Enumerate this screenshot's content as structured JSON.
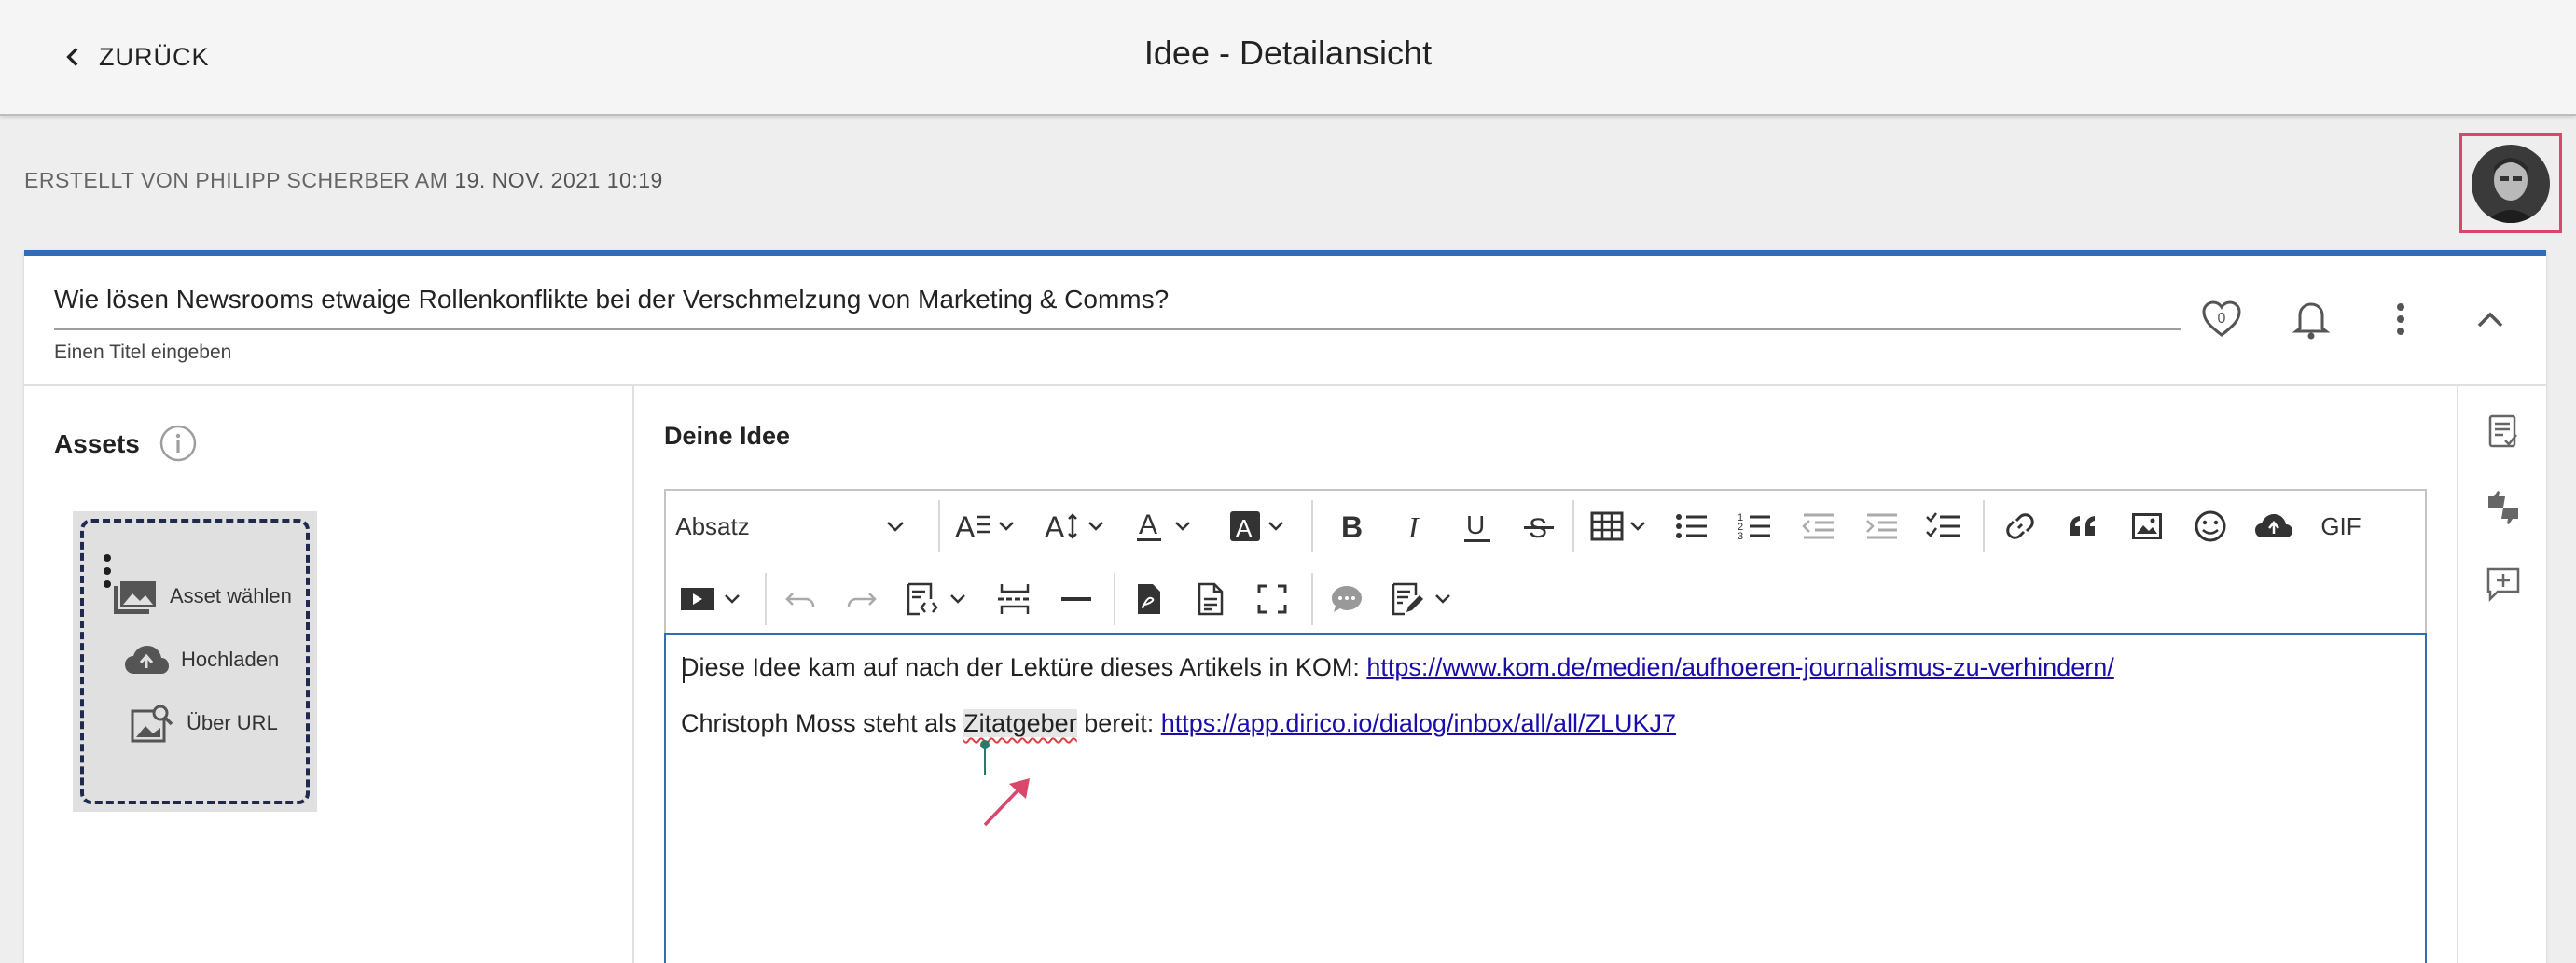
{
  "header": {
    "back_label": "ZURÜCK",
    "title": "Idee - Detailansicht"
  },
  "meta": {
    "prefix": "ERSTELLT VON PHILIPP SCHERBER AM",
    "date": "19. NOV. 2021 10:19"
  },
  "idea": {
    "title_value": "Wie lösen Newsrooms etwaige Rollenkonflikte bei der Verschmelzung von Marketing & Comms?",
    "title_hint": "Einen Titel eingeben",
    "likes": "0"
  },
  "assets": {
    "title": "Assets",
    "actions": [
      {
        "label": "Asset wählen",
        "icon": "image-folder-icon"
      },
      {
        "label": "Hochladen",
        "icon": "cloud-upload-icon"
      },
      {
        "label": "Über URL",
        "icon": "image-search-icon"
      }
    ]
  },
  "editor": {
    "section_title": "Deine Idee",
    "paragraph_style": "Absatz",
    "gif_label": "GIF",
    "line1_text": "Diese Idee kam auf nach der Lektüre dieses Artikels in KOM: ",
    "line1_link": "https://www.kom.de/medien/aufhoeren-journalismus-zu-verhindern/",
    "line2_before": "Christoph Moss steht als ",
    "line2_highlight": "Zitatgeber",
    "line2_after": " bereit: ",
    "line2_link": "https://app.dirico.io/dialog/inbox/all/all/ZLUKJ7"
  },
  "colors": {
    "accent": "#2f6db5",
    "highlight_box": "#d9486b",
    "link": "#1a0dab"
  }
}
